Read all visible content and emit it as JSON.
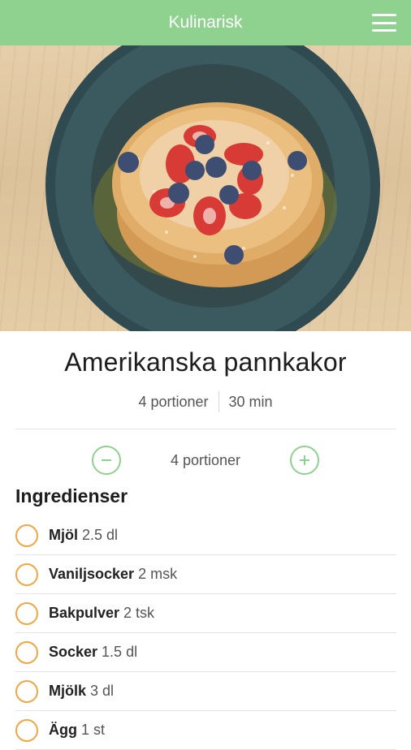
{
  "app": {
    "title": "Kulinarisk"
  },
  "recipe": {
    "title": "Amerikanska pannkakor",
    "servings": "4 portioner",
    "time": "30 min"
  },
  "stepper": {
    "value": "4 portioner"
  },
  "ingredients": {
    "heading": "Ingredienser",
    "items": [
      {
        "name": "Mjöl",
        "amount": "2.5 dl"
      },
      {
        "name": "Vaniljsocker",
        "amount": "2 msk"
      },
      {
        "name": "Bakpulver",
        "amount": "2 tsk"
      },
      {
        "name": "Socker",
        "amount": "1.5 dl"
      },
      {
        "name": "Mjölk",
        "amount": "3 dl"
      },
      {
        "name": "Ägg",
        "amount": "1 st"
      }
    ]
  },
  "colors": {
    "appbar": "#8fd18f",
    "accent_green": "#8fd18f",
    "checkbox_orange": "#f0a640"
  },
  "icons": {
    "menu": "hamburger-menu-icon",
    "decrease": "minus-icon",
    "increase": "plus-icon"
  }
}
